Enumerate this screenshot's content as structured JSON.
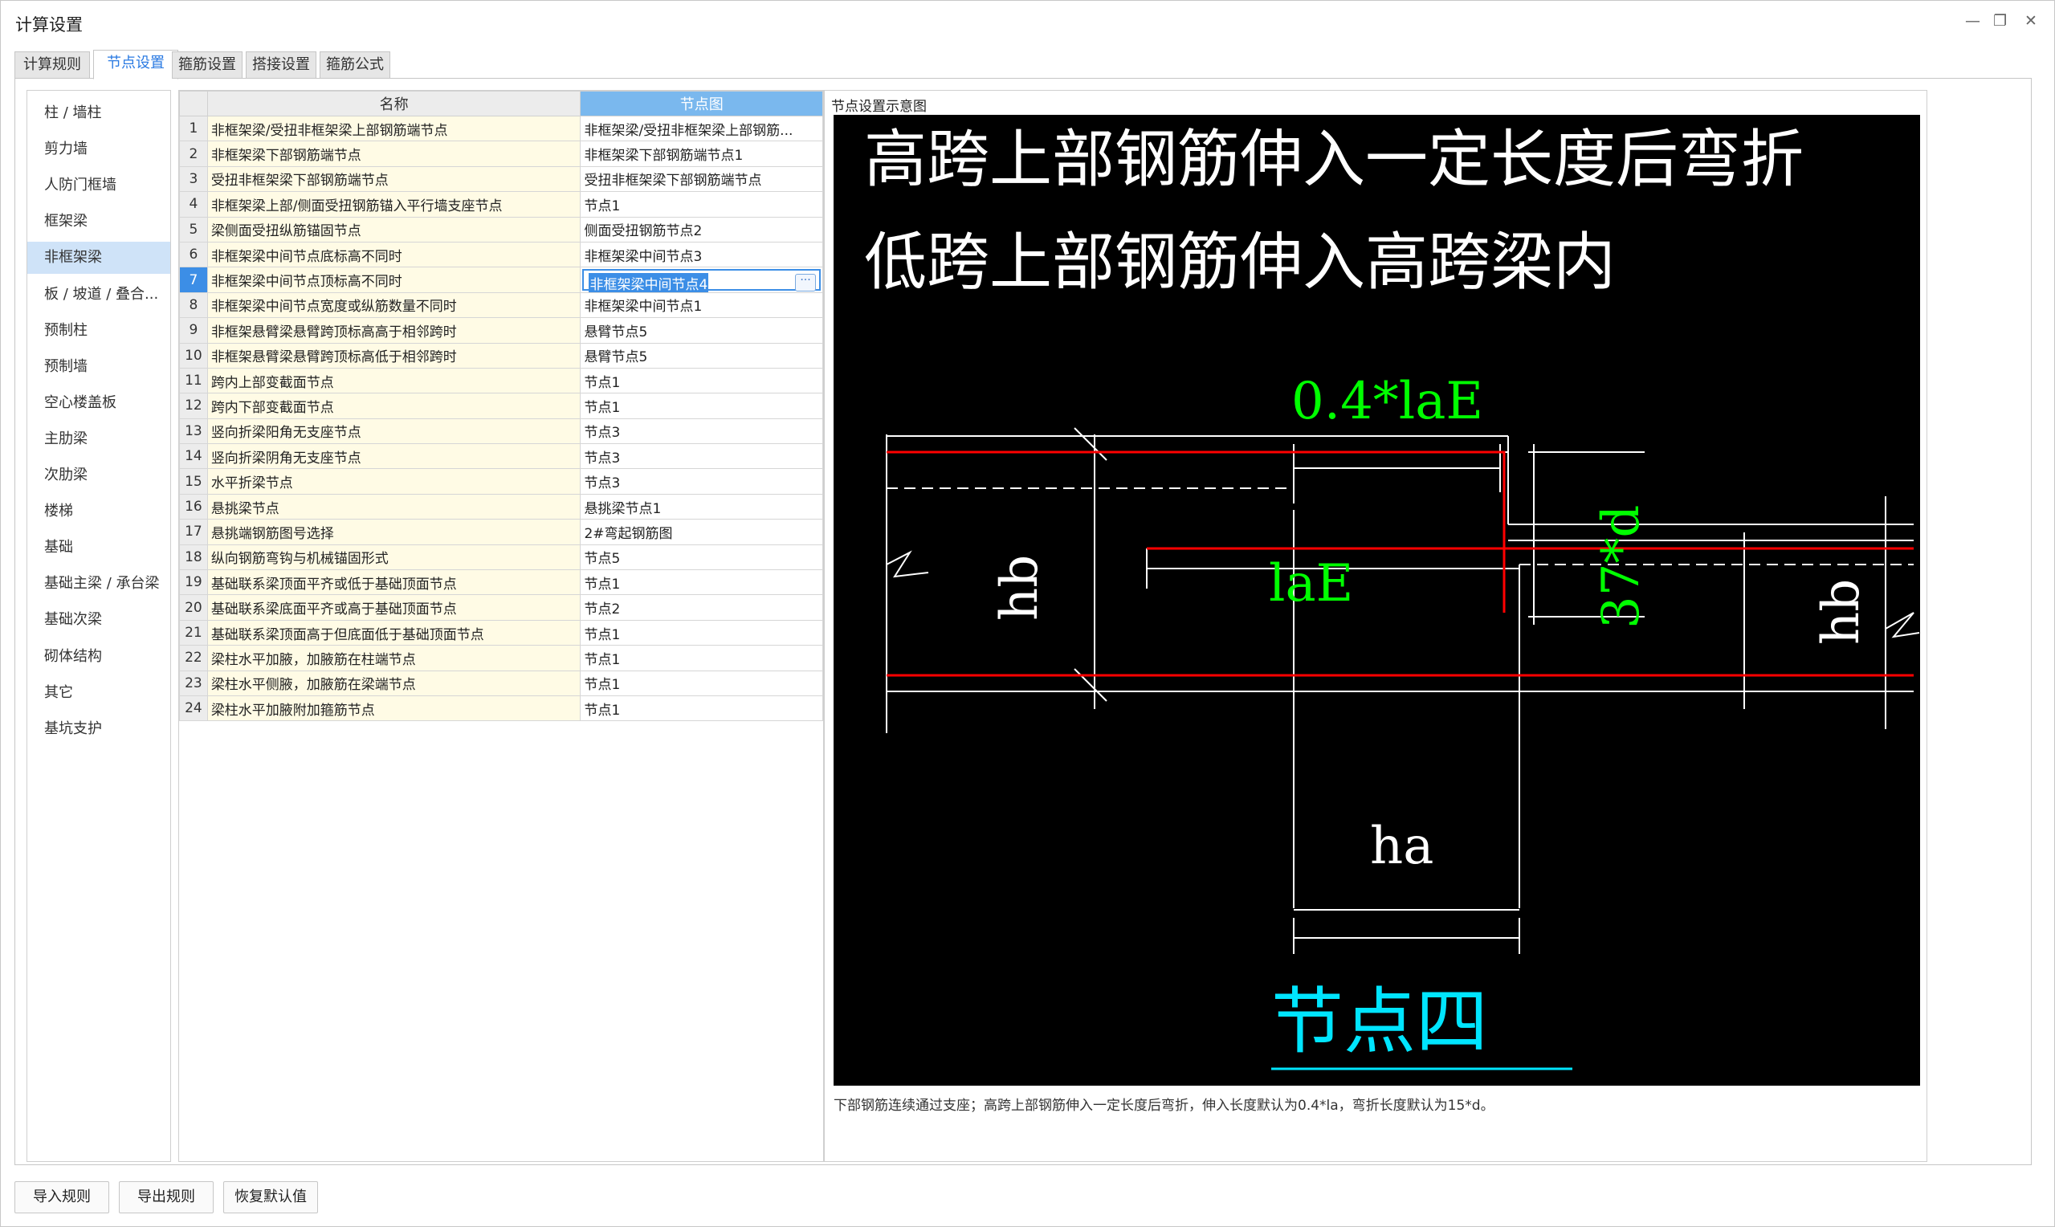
{
  "window": {
    "title": "计算设置",
    "controls": {
      "minimize": "—",
      "restore": "❐",
      "close": "✕"
    }
  },
  "tabs": [
    {
      "label": "计算规则"
    },
    {
      "label": "节点设置",
      "active": true
    },
    {
      "label": "箍筋设置"
    },
    {
      "label": "搭接设置"
    },
    {
      "label": "箍筋公式"
    }
  ],
  "sidebar": {
    "items": [
      {
        "label": "柱 / 墙柱"
      },
      {
        "label": "剪力墙"
      },
      {
        "label": "人防门框墙"
      },
      {
        "label": "框架梁"
      },
      {
        "label": "非框架梁",
        "selected": true
      },
      {
        "label": "板 / 坡道 / 叠合..."
      },
      {
        "label": "预制柱"
      },
      {
        "label": "预制墙"
      },
      {
        "label": "空心楼盖板"
      },
      {
        "label": "主肋梁"
      },
      {
        "label": "次肋梁"
      },
      {
        "label": "楼梯"
      },
      {
        "label": "基础"
      },
      {
        "label": "基础主梁 / 承台梁"
      },
      {
        "label": "基础次梁"
      },
      {
        "label": "砌体结构"
      },
      {
        "label": "其它"
      },
      {
        "label": "基坑支护"
      }
    ]
  },
  "grid": {
    "columns": {
      "name": "名称",
      "node": "节点图"
    },
    "selected_row": 7,
    "rows": [
      {
        "num": "1",
        "name": "非框架梁/受扭非框架梁上部钢筋端节点",
        "node": "非框架梁/受扭非框架梁上部钢筋..."
      },
      {
        "num": "2",
        "name": "非框架梁下部钢筋端节点",
        "node": "非框架梁下部钢筋端节点1"
      },
      {
        "num": "3",
        "name": "受扭非框架梁下部钢筋端节点",
        "node": "受扭非框架梁下部钢筋端节点"
      },
      {
        "num": "4",
        "name": "非框架梁上部/侧面受扭钢筋锚入平行墙支座节点",
        "node": "节点1"
      },
      {
        "num": "5",
        "name": "梁侧面受扭纵筋锚固节点",
        "node": "侧面受扭钢筋节点2"
      },
      {
        "num": "6",
        "name": "非框架梁中间节点底标高不同时",
        "node": "非框架梁中间节点3"
      },
      {
        "num": "7",
        "name": "非框架梁中间节点顶标高不同时",
        "node": "非框架梁中间节点4"
      },
      {
        "num": "8",
        "name": "非框架梁中间节点宽度或纵筋数量不同时",
        "node": "非框架梁中间节点1"
      },
      {
        "num": "9",
        "name": "非框架悬臂梁悬臂跨顶标高高于相邻跨时",
        "node": "悬臂节点5"
      },
      {
        "num": "10",
        "name": "非框架悬臂梁悬臂跨顶标高低于相邻跨时",
        "node": "悬臂节点5"
      },
      {
        "num": "11",
        "name": "跨内上部变截面节点",
        "node": "节点1"
      },
      {
        "num": "12",
        "name": "跨内下部变截面节点",
        "node": "节点1"
      },
      {
        "num": "13",
        "name": "竖向折梁阳角无支座节点",
        "node": "节点3"
      },
      {
        "num": "14",
        "name": "竖向折梁阴角无支座节点",
        "node": "节点3"
      },
      {
        "num": "15",
        "name": "水平折梁节点",
        "node": "节点3"
      },
      {
        "num": "16",
        "name": "悬挑梁节点",
        "node": "悬挑梁节点1"
      },
      {
        "num": "17",
        "name": "悬挑端钢筋图号选择",
        "node": "2#弯起钢筋图"
      },
      {
        "num": "18",
        "name": "纵向钢筋弯钩与机械锚固形式",
        "node": "节点5"
      },
      {
        "num": "19",
        "name": "基础联系梁顶面平齐或低于基础顶面节点",
        "node": "节点1"
      },
      {
        "num": "20",
        "name": "基础联系梁底面平齐或高于基础顶面节点",
        "node": "节点2"
      },
      {
        "num": "21",
        "name": "基础联系梁顶面高于但底面低于基础顶面节点",
        "node": "节点1"
      },
      {
        "num": "22",
        "name": "梁柱水平加腋，加腋筋在柱端节点",
        "node": "节点1"
      },
      {
        "num": "23",
        "name": "梁柱水平侧腋，加腋筋在梁端节点",
        "node": "节点1"
      },
      {
        "num": "24",
        "name": "梁柱水平加腋附加箍筋节点",
        "node": "节点1"
      }
    ]
  },
  "diagram": {
    "label": "节点设置示意图",
    "line1": "高跨上部钢筋伸入一定长度后弯折",
    "line2": "低跨上部钢筋伸入高跨梁内",
    "dim_04lae": "0.4*laE",
    "dim_37d": "37*d",
    "dim_lae": "laE",
    "label_hb_left": "hb",
    "label_hb_right": "hb",
    "label_ha": "ha",
    "node_title": "节点四",
    "colors": {
      "background": "#000000",
      "text": "#ffffff",
      "dimension": "#00ff00",
      "rebar": "#ff0000",
      "title": "#00e5ff"
    },
    "description": "下部钢筋连续通过支座；高跨上部钢筋伸入一定长度后弯折，伸入长度默认为0.4*la，弯折长度默认为15*d。"
  },
  "buttons": {
    "import": "导入规则",
    "export": "导出规则",
    "restore": "恢复默认值"
  }
}
